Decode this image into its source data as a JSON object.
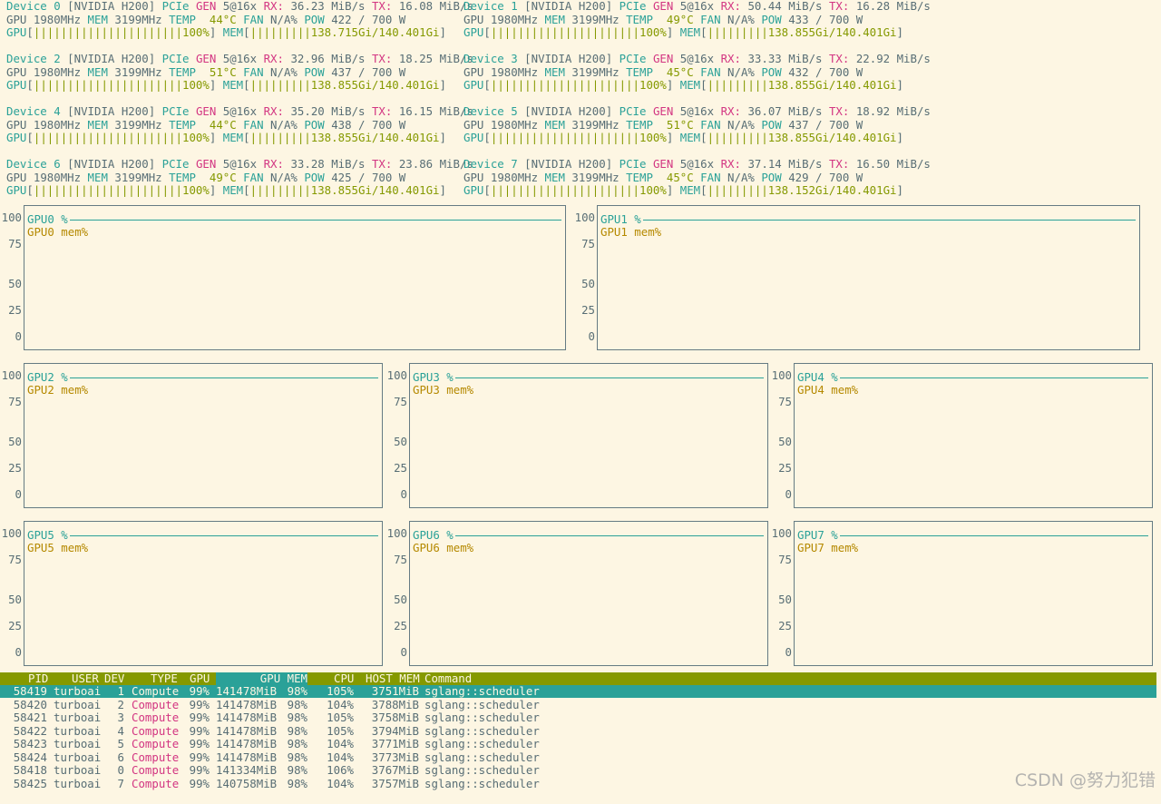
{
  "devices": [
    {
      "id": "0",
      "model": "[NVIDIA H200]",
      "pcie_gen": "5@16x",
      "rx": "36.23 MiB/s",
      "tx": "16.08 MiB/s",
      "gpu_clock": "1980MHz",
      "mem_clock": "3199MHz",
      "temp": "44°C",
      "fan": "N/A%",
      "pow": "422 / 700 W",
      "gpu_bar": "||||||||||||||||||||||",
      "gpu_util": "100%",
      "mem_bar": "|||||||||",
      "mem_usage": "138.715Gi/140.401Gi"
    },
    {
      "id": "1",
      "model": "[NVIDIA H200]",
      "pcie_gen": "5@16x",
      "rx": "50.44 MiB/s",
      "tx": "16.28 MiB/s",
      "gpu_clock": "1980MHz",
      "mem_clock": "3199MHz",
      "temp": "49°C",
      "fan": "N/A%",
      "pow": "433 / 700 W",
      "gpu_bar": "||||||||||||||||||||||",
      "gpu_util": "100%",
      "mem_bar": "|||||||||",
      "mem_usage": "138.855Gi/140.401Gi"
    },
    {
      "id": "2",
      "model": "[NVIDIA H200]",
      "pcie_gen": "5@16x",
      "rx": "32.96 MiB/s",
      "tx": "18.25 MiB/s",
      "gpu_clock": "1980MHz",
      "mem_clock": "3199MHz",
      "temp": "51°C",
      "fan": "N/A%",
      "pow": "437 / 700 W",
      "gpu_bar": "||||||||||||||||||||||",
      "gpu_util": "100%",
      "mem_bar": "|||||||||",
      "mem_usage": "138.855Gi/140.401Gi"
    },
    {
      "id": "3",
      "model": "[NVIDIA H200]",
      "pcie_gen": "5@16x",
      "rx": "33.33 MiB/s",
      "tx": "22.92 MiB/s",
      "gpu_clock": "1980MHz",
      "mem_clock": "3199MHz",
      "temp": "45°C",
      "fan": "N/A%",
      "pow": "432 / 700 W",
      "gpu_bar": "||||||||||||||||||||||",
      "gpu_util": "100%",
      "mem_bar": "|||||||||",
      "mem_usage": "138.855Gi/140.401Gi"
    },
    {
      "id": "4",
      "model": "[NVIDIA H200]",
      "pcie_gen": "5@16x",
      "rx": "35.20 MiB/s",
      "tx": "16.15 MiB/s",
      "gpu_clock": "1980MHz",
      "mem_clock": "3199MHz",
      "temp": "44°C",
      "fan": "N/A%",
      "pow": "438 / 700 W",
      "gpu_bar": "||||||||||||||||||||||",
      "gpu_util": "100%",
      "mem_bar": "|||||||||",
      "mem_usage": "138.855Gi/140.401Gi"
    },
    {
      "id": "5",
      "model": "[NVIDIA H200]",
      "pcie_gen": "5@16x",
      "rx": "36.07 MiB/s",
      "tx": "18.92 MiB/s",
      "gpu_clock": "1980MHz",
      "mem_clock": "3199MHz",
      "temp": "51°C",
      "fan": "N/A%",
      "pow": "437 / 700 W",
      "gpu_bar": "||||||||||||||||||||||",
      "gpu_util": "100%",
      "mem_bar": "|||||||||",
      "mem_usage": "138.855Gi/140.401Gi"
    },
    {
      "id": "6",
      "model": "[NVIDIA H200]",
      "pcie_gen": "5@16x",
      "rx": "33.28 MiB/s",
      "tx": "23.86 MiB/s",
      "gpu_clock": "1980MHz",
      "mem_clock": "3199MHz",
      "temp": "49°C",
      "fan": "N/A%",
      "pow": "425 / 700 W",
      "gpu_bar": "||||||||||||||||||||||",
      "gpu_util": "100%",
      "mem_bar": "|||||||||",
      "mem_usage": "138.855Gi/140.401Gi"
    },
    {
      "id": "7",
      "model": "[NVIDIA H200]",
      "pcie_gen": "5@16x",
      "rx": "37.14 MiB/s",
      "tx": "16.50 MiB/s",
      "gpu_clock": "1980MHz",
      "mem_clock": "3199MHz",
      "temp": "45°C",
      "fan": "N/A%",
      "pow": "429 / 700 W",
      "gpu_bar": "||||||||||||||||||||||",
      "gpu_util": "100%",
      "mem_bar": "|||||||||",
      "mem_usage": "138.152Gi/140.401Gi"
    }
  ],
  "labels": {
    "device": "Device",
    "pcie": "PCIe",
    "gen": "GEN",
    "rx": "RX:",
    "tx": "TX:",
    "gpu": "GPU",
    "mem": "MEM",
    "temp": "TEMP",
    "fan": "FAN",
    "pow": "POW",
    "bar_open": "[",
    "bar_close": "]"
  },
  "charts": [
    {
      "util_label": "GPU0 %",
      "mem_label": "GPU0 mem%"
    },
    {
      "util_label": "GPU1 %",
      "mem_label": "GPU1 mem%"
    },
    {
      "util_label": "GPU2 %",
      "mem_label": "GPU2 mem%"
    },
    {
      "util_label": "GPU3 %",
      "mem_label": "GPU3 mem%"
    },
    {
      "util_label": "GPU4 %",
      "mem_label": "GPU4 mem%"
    },
    {
      "util_label": "GPU5 %",
      "mem_label": "GPU5 mem%"
    },
    {
      "util_label": "GPU6 %",
      "mem_label": "GPU6 mem%"
    },
    {
      "util_label": "GPU7 %",
      "mem_label": "GPU7 mem%"
    }
  ],
  "chart_axis": [
    "100",
    "75",
    "50",
    "25",
    "0"
  ],
  "process_table": {
    "headers": {
      "pid": "PID",
      "user": "USER",
      "dev": "DEV",
      "type": "TYPE",
      "gpu": "GPU",
      "gpu_mem": "GPU MEM",
      "cpu": "CPU",
      "host_mem": "HOST MEM",
      "command": "Command"
    },
    "rows": [
      {
        "pid": "58419",
        "user": "turboai",
        "dev": "1",
        "type": "Compute",
        "gpu": "99%",
        "gpu_mem": "141478MiB",
        "mem_pct": "98%",
        "cpu": "105%",
        "host_mem": "3751MiB",
        "command": "sglang::scheduler"
      },
      {
        "pid": "58420",
        "user": "turboai",
        "dev": "2",
        "type": "Compute",
        "gpu": "99%",
        "gpu_mem": "141478MiB",
        "mem_pct": "98%",
        "cpu": "104%",
        "host_mem": "3788MiB",
        "command": "sglang::scheduler"
      },
      {
        "pid": "58421",
        "user": "turboai",
        "dev": "3",
        "type": "Compute",
        "gpu": "99%",
        "gpu_mem": "141478MiB",
        "mem_pct": "98%",
        "cpu": "105%",
        "host_mem": "3758MiB",
        "command": "sglang::scheduler"
      },
      {
        "pid": "58422",
        "user": "turboai",
        "dev": "4",
        "type": "Compute",
        "gpu": "99%",
        "gpu_mem": "141478MiB",
        "mem_pct": "98%",
        "cpu": "105%",
        "host_mem": "3794MiB",
        "command": "sglang::scheduler"
      },
      {
        "pid": "58423",
        "user": "turboai",
        "dev": "5",
        "type": "Compute",
        "gpu": "99%",
        "gpu_mem": "141478MiB",
        "mem_pct": "98%",
        "cpu": "104%",
        "host_mem": "3771MiB",
        "command": "sglang::scheduler"
      },
      {
        "pid": "58424",
        "user": "turboai",
        "dev": "6",
        "type": "Compute",
        "gpu": "99%",
        "gpu_mem": "141478MiB",
        "mem_pct": "98%",
        "cpu": "104%",
        "host_mem": "3773MiB",
        "command": "sglang::scheduler"
      },
      {
        "pid": "58418",
        "user": "turboai",
        "dev": "0",
        "type": "Compute",
        "gpu": "99%",
        "gpu_mem": "141334MiB",
        "mem_pct": "98%",
        "cpu": "106%",
        "host_mem": "3767MiB",
        "command": "sglang::scheduler"
      },
      {
        "pid": "58425",
        "user": "turboai",
        "dev": "7",
        "type": "Compute",
        "gpu": "99%",
        "gpu_mem": "140758MiB",
        "mem_pct": "98%",
        "cpu": "104%",
        "host_mem": "3757MiB",
        "command": "sglang::scheduler"
      }
    ]
  },
  "watermark": "CSDN @努力犯错",
  "colors": {
    "background": "#fdf6e3",
    "text": "#586e75",
    "cyan": "#2aa198",
    "magenta": "#d33682",
    "green": "#859900",
    "yellow": "#b58900"
  }
}
